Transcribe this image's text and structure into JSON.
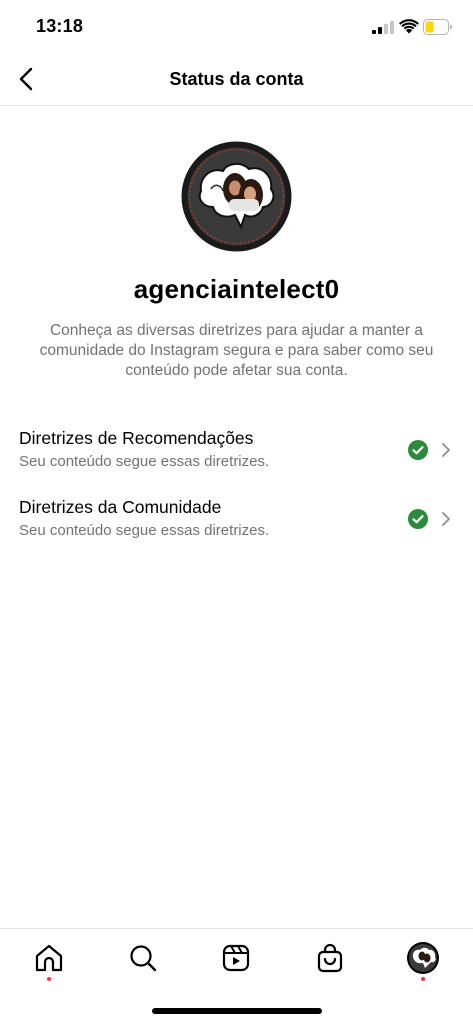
{
  "status_bar": {
    "time": "13:18",
    "icons": [
      "cellular-signal-icon",
      "wifi-icon",
      "battery-icon"
    ],
    "battery_color": "#ffd60a"
  },
  "nav": {
    "title": "Status da conta",
    "back_icon": "chevron-left-icon"
  },
  "profile": {
    "username": "agenciaintelect0",
    "description": "Conheça as diversas diretrizes para ajudar a manter a comunidade do Instagram segura e para saber como seu conteúdo pode afetar sua conta."
  },
  "guidelines": [
    {
      "title": "Diretrizes de Recomendações",
      "subtitle": "Seu conteúdo segue essas diretrizes.",
      "status_icon": "check-circle-icon"
    },
    {
      "title": "Diretrizes da Comunidade",
      "subtitle": "Seu conteúdo segue essas diretrizes.",
      "status_icon": "check-circle-icon"
    }
  ],
  "tab_bar": {
    "tabs": [
      "home-icon",
      "search-icon",
      "reels-icon",
      "shop-icon",
      "profile-avatar"
    ],
    "notification_dot_color": "#ff3040"
  },
  "colors": {
    "check_green": "#2c8a3c",
    "secondary_text": "#737373",
    "divider": "#e6e6e6"
  }
}
